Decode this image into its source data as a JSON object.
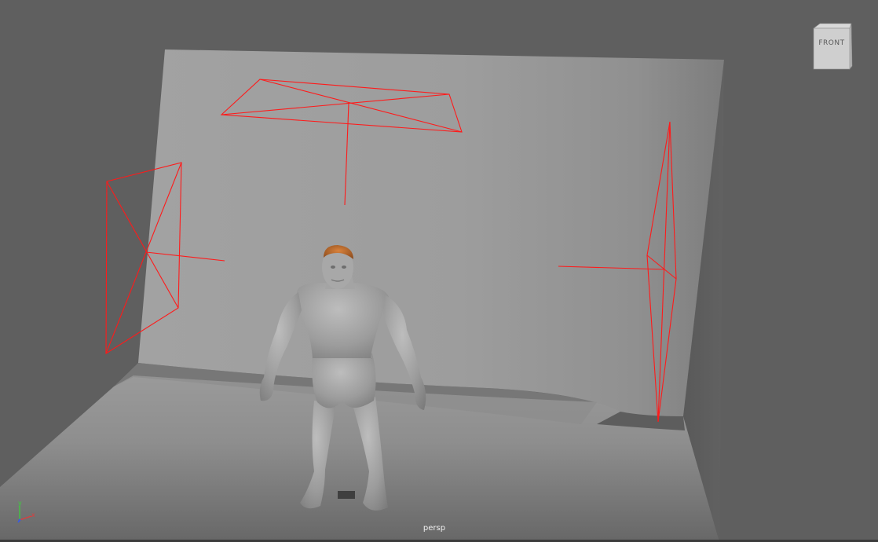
{
  "viewport": {
    "camera_name": "persp"
  },
  "viewcube": {
    "face_label": "FRONT"
  },
  "axis_gizmo": {
    "y_label": "y",
    "x_label": "x",
    "colors": {
      "x": "#e23b3b",
      "y": "#3bd13b",
      "z": "#3b5be2"
    }
  },
  "scene": {
    "light_color": "#ff1a1a",
    "objects": [
      {
        "name": "backdrop",
        "type": "mesh"
      },
      {
        "name": "character",
        "type": "mesh"
      },
      {
        "name": "top-area-light",
        "type": "area-light"
      },
      {
        "name": "left-area-light",
        "type": "area-light"
      },
      {
        "name": "right-area-light",
        "type": "area-light"
      }
    ]
  }
}
